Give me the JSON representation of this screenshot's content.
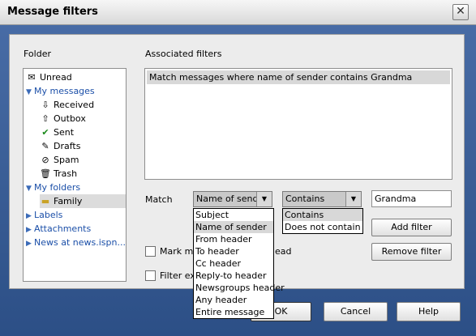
{
  "window": {
    "title": "Message filters"
  },
  "folder_section": {
    "label": "Folder",
    "items": [
      {
        "label": "Unread",
        "icon": "envelope-icon"
      },
      {
        "label": "My messages",
        "icon": "expanded-triangle-icon"
      },
      {
        "label": "Received",
        "icon": "arrow-down-icon"
      },
      {
        "label": "Outbox",
        "icon": "arrow-up-icon"
      },
      {
        "label": "Sent",
        "icon": "check-icon"
      },
      {
        "label": "Drafts",
        "icon": "draft-icon"
      },
      {
        "label": "Spam",
        "icon": "spam-icon"
      },
      {
        "label": "Trash",
        "icon": "trash-icon"
      },
      {
        "label": "My folders",
        "icon": "expanded-triangle-icon"
      },
      {
        "label": "Family",
        "icon": "folder-icon"
      },
      {
        "label": "Labels",
        "icon": "collapsed-triangle-icon"
      },
      {
        "label": "Attachments",
        "icon": "collapsed-triangle-icon"
      },
      {
        "label": "News at news.ispn...",
        "icon": "collapsed-triangle-icon"
      }
    ]
  },
  "filters_section": {
    "label": "Associated filters",
    "items": [
      "Match messages where name of sender contains Grandma"
    ]
  },
  "match": {
    "label": "Match",
    "field_value": "Name of sender",
    "condition_value": "Contains",
    "text_value": "Grandma",
    "field_options": [
      "Subject",
      "Name of sender",
      "From header",
      "To header",
      "Cc header",
      "Reply-to header",
      "Newsgroups header",
      "Any header",
      "Entire message"
    ],
    "condition_options": [
      "Contains",
      "Does not contain"
    ]
  },
  "checkboxes": {
    "mark_label_left": "Mark ma",
    "mark_label_right": "ead",
    "filter_label_left": "Filter ex"
  },
  "buttons": {
    "add": "Add filter",
    "remove": "Remove filter",
    "ok": "OK",
    "cancel": "Cancel",
    "help": "Help"
  },
  "colors": {
    "accent_blue": "#1b4fa8",
    "frame": "#3a5a8c"
  }
}
